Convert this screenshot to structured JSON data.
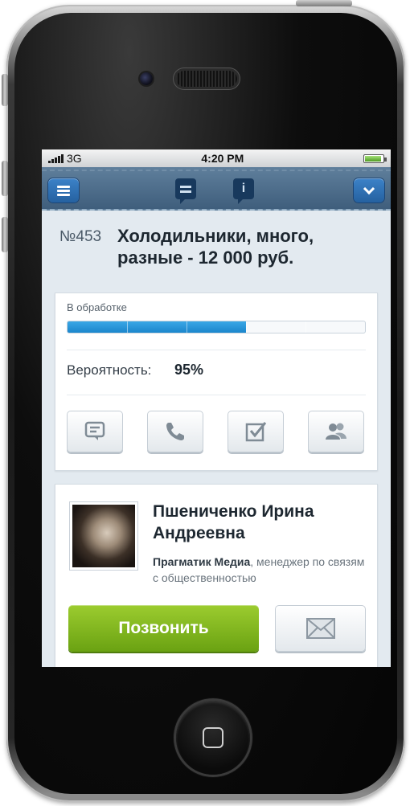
{
  "status_bar": {
    "carrier": "3G",
    "time": "4:20 PM"
  },
  "nav": {
    "menu_icon": "menu-icon",
    "notes_icon": "note-icon",
    "info_icon": "info-icon",
    "info_glyph": "i",
    "dropdown_icon": "chevron-down-icon"
  },
  "deal": {
    "number": "№453",
    "title": "Холодильники, много, разные - 12 000 руб."
  },
  "status": {
    "stage_label": "В обработке",
    "progress_fraction": 0.6,
    "probability_label": "Вероятность:",
    "probability_value": "95%"
  },
  "actions": [
    {
      "icon": "comment-icon"
    },
    {
      "icon": "phone-icon"
    },
    {
      "icon": "task-check-icon"
    },
    {
      "icon": "contacts-icon"
    }
  ],
  "contact": {
    "name": "Пшениченко Ирина Андреевна",
    "company": "Прагматик Медиа",
    "position": ", менеджер по связям с общественностью",
    "call_label": "Позвонить",
    "mail_icon": "mail-icon"
  },
  "colors": {
    "accent_blue": "#1b86cc",
    "call_green": "#7bb11c",
    "nav_bar": "#4d6d8b"
  }
}
